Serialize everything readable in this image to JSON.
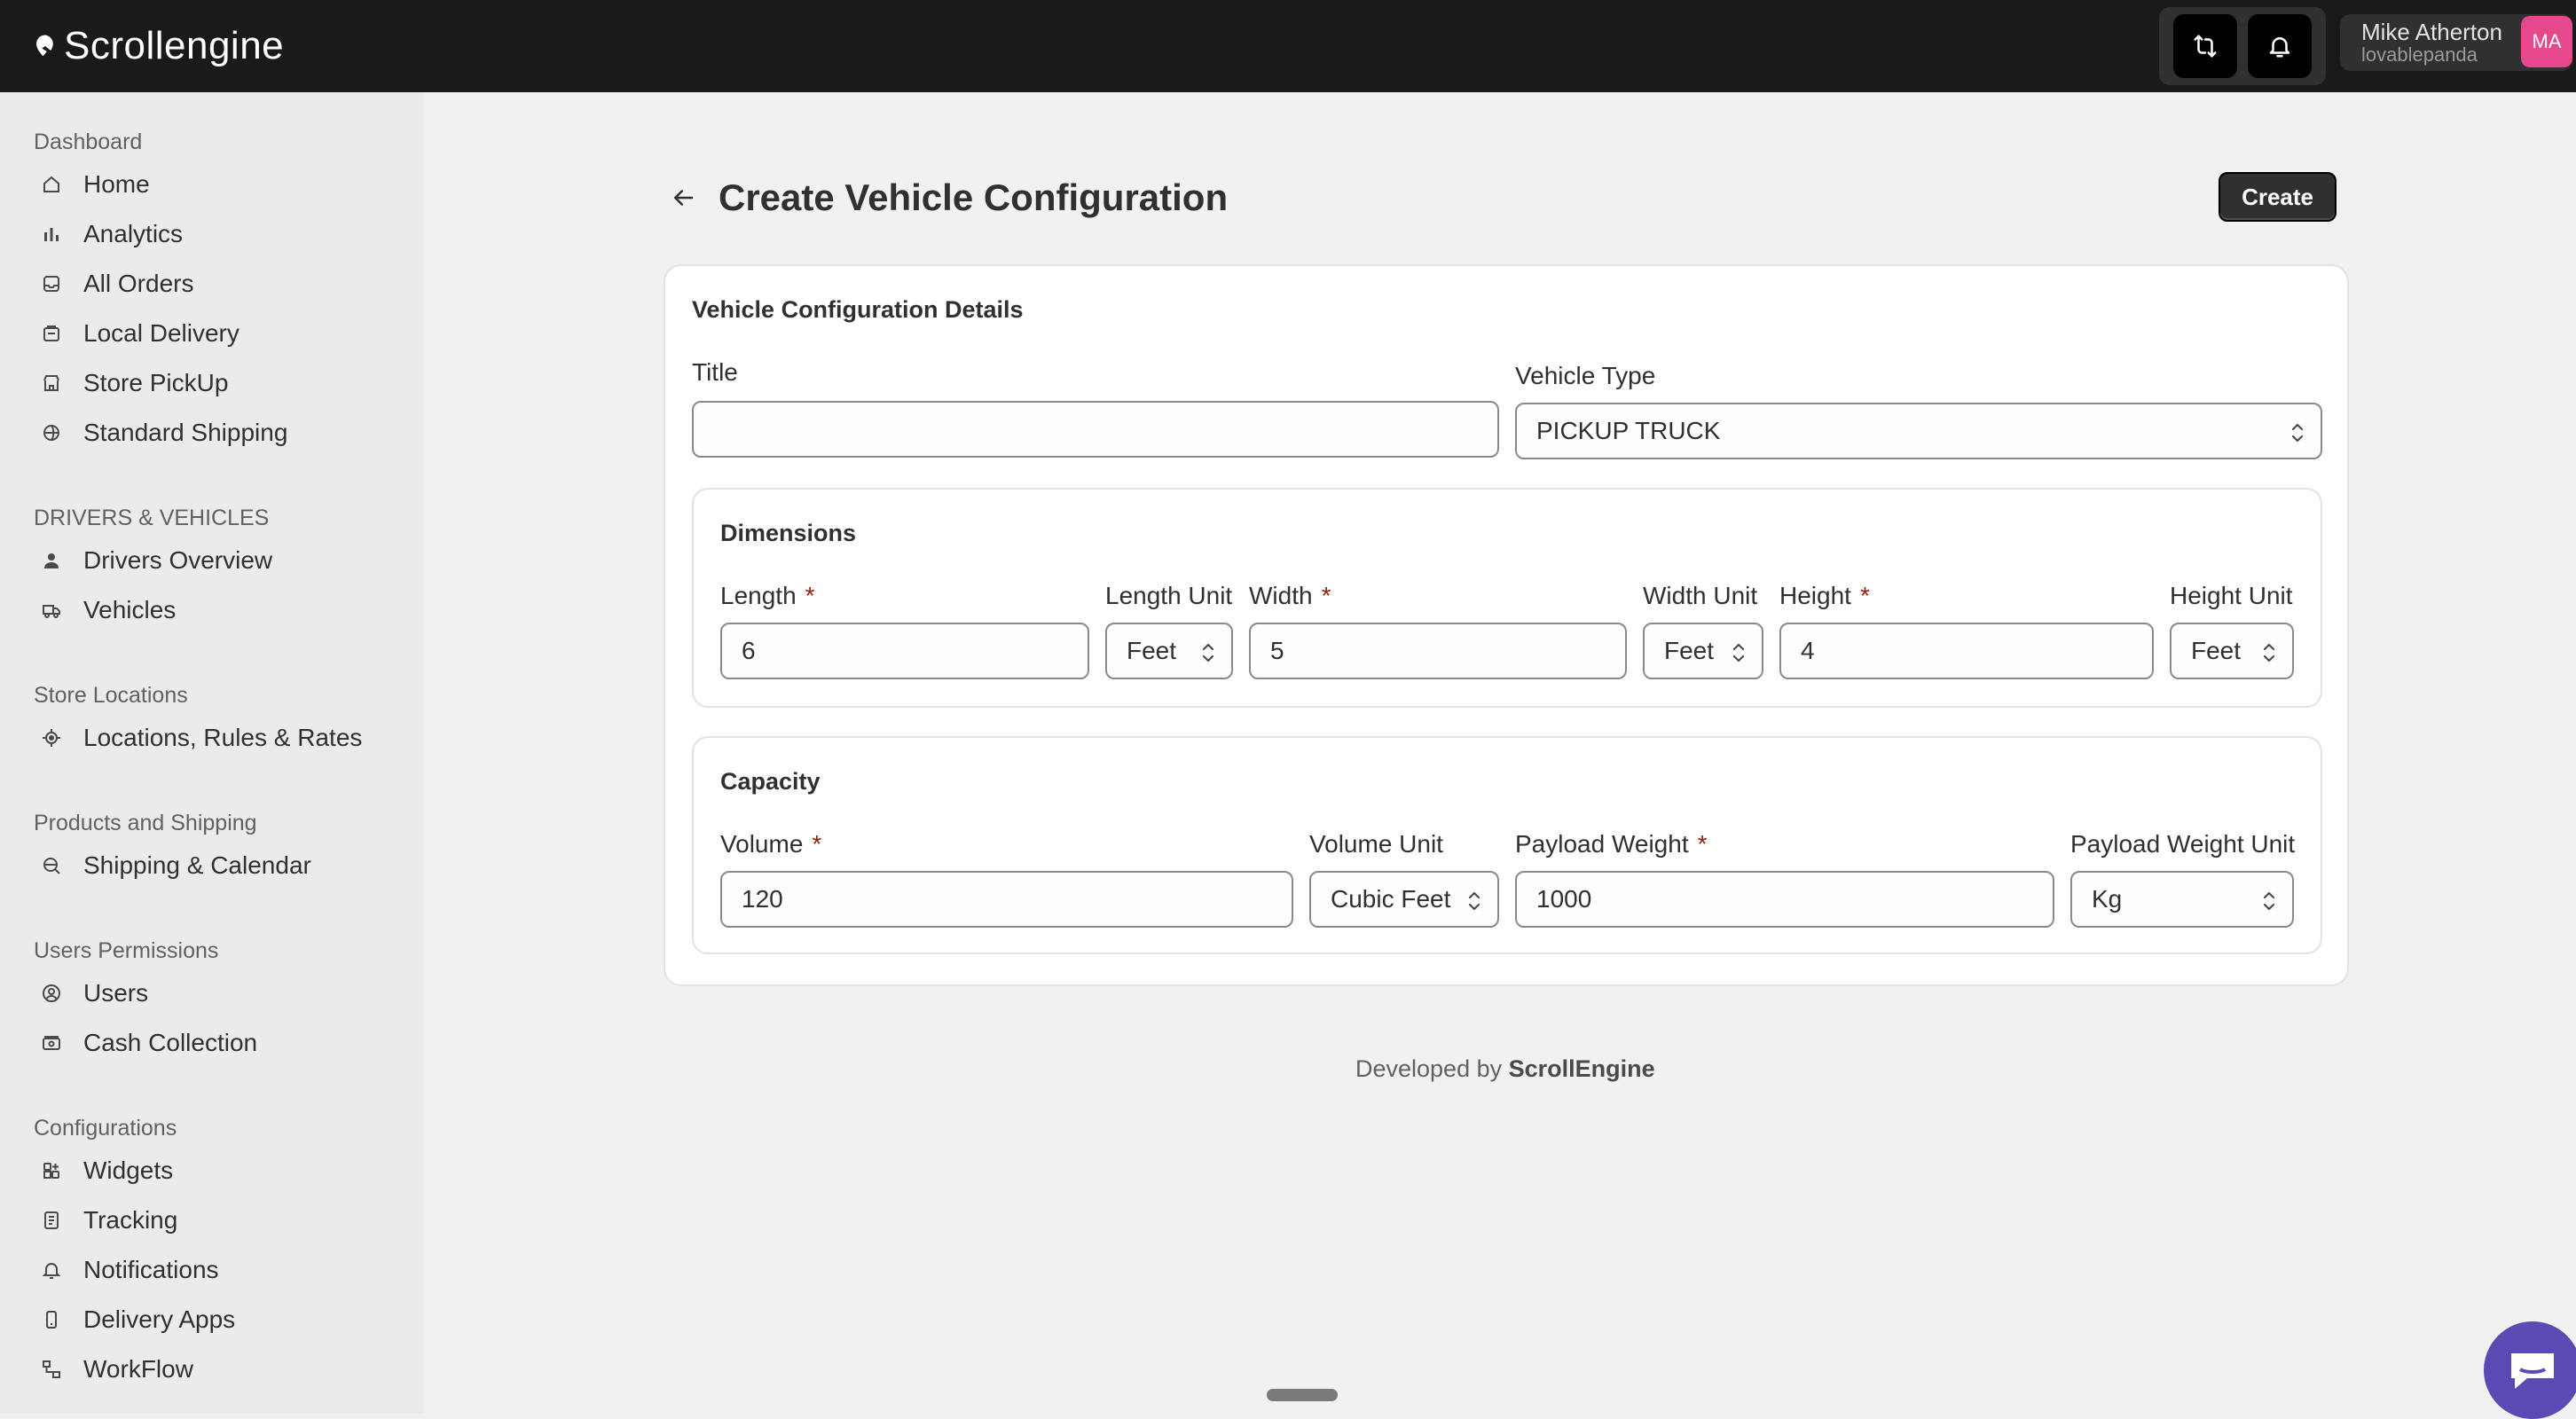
{
  "app": {
    "name": "Scrollengine"
  },
  "user": {
    "name": "Mike Atherton",
    "handle": "lovablepanda",
    "initials": "MA"
  },
  "sidebar": {
    "sections": [
      {
        "title": "Dashboard",
        "items": [
          {
            "label": "Home",
            "icon": "home-icon"
          },
          {
            "label": "Analytics",
            "icon": "bar-chart-icon"
          },
          {
            "label": "All Orders",
            "icon": "inbox-icon"
          },
          {
            "label": "Local Delivery",
            "icon": "delivery-box-icon"
          },
          {
            "label": "Store PickUp",
            "icon": "store-icon"
          },
          {
            "label": "Standard Shipping",
            "icon": "globe-icon"
          }
        ]
      },
      {
        "title": "DRIVERS & VEHICLES",
        "items": [
          {
            "label": "Drivers Overview",
            "icon": "person-icon"
          },
          {
            "label": "Vehicles",
            "icon": "truck-icon"
          }
        ]
      },
      {
        "title": "Store Locations",
        "items": [
          {
            "label": "Locations, Rules & Rates",
            "icon": "location-target-icon"
          }
        ]
      },
      {
        "title": "Products and Shipping",
        "items": [
          {
            "label": "Shipping & Calendar",
            "icon": "search-globe-icon"
          }
        ]
      },
      {
        "title": "Users Permissions",
        "items": [
          {
            "label": "Users",
            "icon": "user-circle-icon"
          },
          {
            "label": "Cash Collection",
            "icon": "cash-icon"
          }
        ]
      },
      {
        "title": "Configurations",
        "items": [
          {
            "label": "Widgets",
            "icon": "widget-icon"
          },
          {
            "label": "Tracking",
            "icon": "receipt-icon"
          },
          {
            "label": "Notifications",
            "icon": "bell-icon"
          },
          {
            "label": "Delivery Apps",
            "icon": "mobile-icon"
          },
          {
            "label": "WorkFlow",
            "icon": "workflow-icon"
          }
        ]
      }
    ]
  },
  "page": {
    "title": "Create Vehicle Configuration",
    "create_label": "Create",
    "card_title": "Vehicle Configuration Details",
    "title_field": {
      "label": "Title",
      "value": ""
    },
    "vehicle_type": {
      "label": "Vehicle Type",
      "value": "PICKUP TRUCK"
    },
    "dimensions": {
      "title": "Dimensions",
      "length": {
        "label": "Length",
        "value": "6"
      },
      "length_unit": {
        "label": "Length Unit",
        "value": "Feet"
      },
      "width": {
        "label": "Width",
        "value": "5"
      },
      "width_unit": {
        "label": "Width Unit",
        "value": "Feet"
      },
      "height": {
        "label": "Height",
        "value": "4"
      },
      "height_unit": {
        "label": "Height Unit",
        "value": "Feet"
      }
    },
    "capacity": {
      "title": "Capacity",
      "volume": {
        "label": "Volume",
        "value": "120"
      },
      "volume_unit": {
        "label": "Volume Unit",
        "value": "Cubic Feet"
      },
      "payload": {
        "label": "Payload Weight",
        "value": "1000"
      },
      "payload_unit": {
        "label": "Payload Weight Unit",
        "value": "Kg"
      }
    },
    "required_mark": "*"
  },
  "footer": {
    "prefix": "Developed by",
    "brand": "ScrollEngine"
  }
}
